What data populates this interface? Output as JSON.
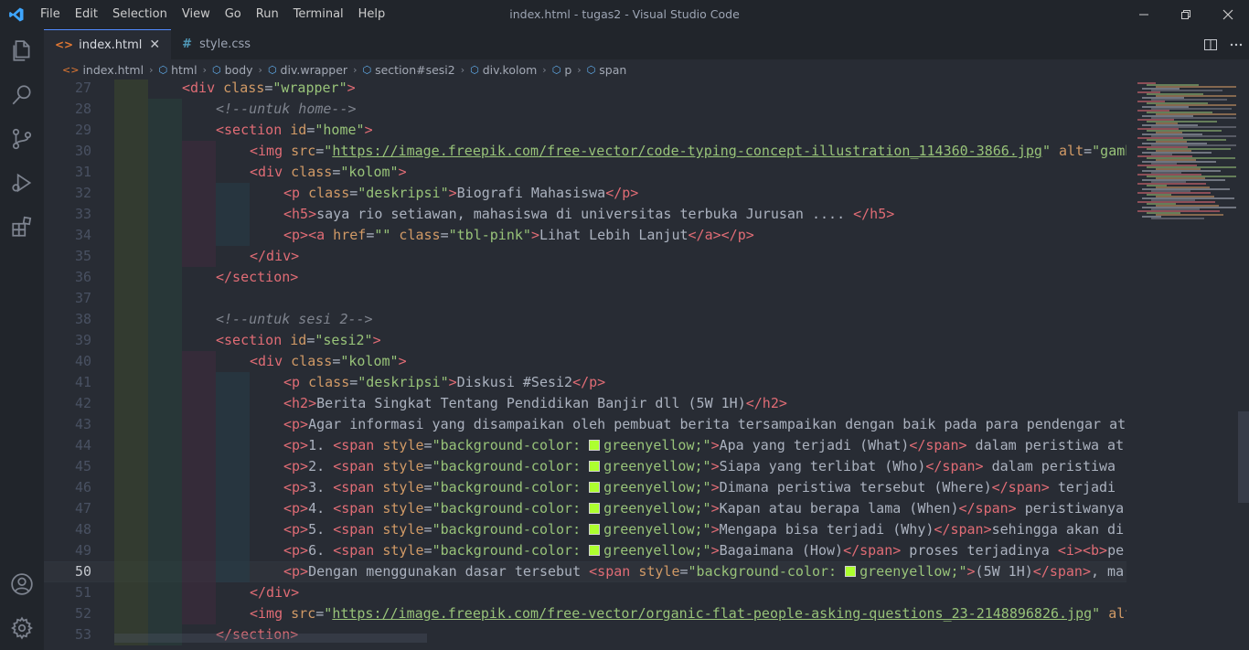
{
  "window": {
    "title": "index.html - tugas2 - Visual Studio Code",
    "menu": [
      "File",
      "Edit",
      "Selection",
      "View",
      "Go",
      "Run",
      "Terminal",
      "Help"
    ]
  },
  "activity_bar": {
    "top": [
      "files-icon",
      "search-icon",
      "source-control-icon",
      "run-debug-icon",
      "extensions-icon"
    ],
    "bottom": [
      "account-icon",
      "settings-gear-icon"
    ]
  },
  "tabs": [
    {
      "label": "index.html",
      "icon": "<>",
      "active": true,
      "close": "✕"
    },
    {
      "label": "style.css",
      "icon": "#",
      "active": false
    }
  ],
  "breadcrumbs": [
    {
      "label": "index.html",
      "icon": "<>"
    },
    {
      "label": "html",
      "icon": "⬡"
    },
    {
      "label": "body",
      "icon": "⬡"
    },
    {
      "label": "div.wrapper",
      "icon": "⬡"
    },
    {
      "label": "section#sesi2",
      "icon": "⬡"
    },
    {
      "label": "div.kolom",
      "icon": "⬡"
    },
    {
      "label": "p",
      "icon": "⬡"
    },
    {
      "label": "span",
      "icon": "⬡"
    }
  ],
  "colors": {
    "tag": "#e06c75",
    "attribute": "#d19a66",
    "string": "#98c379",
    "comment": "#7f848e",
    "swatch": "#adff2f",
    "accent": "#528bff"
  },
  "editor": {
    "current_line": 50,
    "lines": [
      {
        "n": "27",
        "indent": 1,
        "tokens": [
          [
            "tag",
            "<div"
          ],
          [
            "attr",
            " class"
          ],
          [
            "punc",
            "="
          ],
          [
            "str",
            "\"wrapper\""
          ],
          [
            "tag",
            ">"
          ]
        ]
      },
      {
        "n": "28",
        "indent": 2,
        "tokens": [
          [
            "comment",
            "<!--untuk home-->"
          ]
        ]
      },
      {
        "n": "29",
        "indent": 2,
        "tokens": [
          [
            "tag",
            "<section"
          ],
          [
            "attr",
            " id"
          ],
          [
            "punc",
            "="
          ],
          [
            "str",
            "\"home\""
          ],
          [
            "tag",
            ">"
          ]
        ]
      },
      {
        "n": "30",
        "indent": 3,
        "tokens": [
          [
            "tag",
            "<img"
          ],
          [
            "attr",
            " src"
          ],
          [
            "punc",
            "="
          ],
          [
            "str",
            "\""
          ],
          [
            "url",
            "https://image.freepik.com/free-vector/code-typing-concept-illustration_114360-3866.jpg"
          ],
          [
            "str",
            "\""
          ],
          [
            "attr",
            " alt"
          ],
          [
            "punc",
            "="
          ],
          [
            "str",
            "\"gamb"
          ]
        ]
      },
      {
        "n": "31",
        "indent": 3,
        "tokens": [
          [
            "tag",
            "<div"
          ],
          [
            "attr",
            " class"
          ],
          [
            "punc",
            "="
          ],
          [
            "str",
            "\"kolom\""
          ],
          [
            "tag",
            ">"
          ]
        ]
      },
      {
        "n": "32",
        "indent": 4,
        "tokens": [
          [
            "tag",
            "<p"
          ],
          [
            "attr",
            " class"
          ],
          [
            "punc",
            "="
          ],
          [
            "str",
            "\"deskripsi\""
          ],
          [
            "tag",
            ">"
          ],
          [
            "text",
            "Biografi Mahasiswa"
          ],
          [
            "tag",
            "</p>"
          ]
        ]
      },
      {
        "n": "33",
        "indent": 4,
        "tokens": [
          [
            "tag",
            "<h5>"
          ],
          [
            "text",
            "saya rio setiawan, mahasiswa di universitas terbuka Jurusan .... "
          ],
          [
            "tag",
            "</h5>"
          ]
        ]
      },
      {
        "n": "34",
        "indent": 4,
        "tokens": [
          [
            "tag",
            "<p><a"
          ],
          [
            "attr",
            " href"
          ],
          [
            "punc",
            "="
          ],
          [
            "str",
            "\"\""
          ],
          [
            "attr",
            " class"
          ],
          [
            "punc",
            "="
          ],
          [
            "str",
            "\"tbl-pink\""
          ],
          [
            "tag",
            ">"
          ],
          [
            "text",
            "Lihat Lebih Lanjut"
          ],
          [
            "tag",
            "</a></p>"
          ]
        ]
      },
      {
        "n": "35",
        "indent": 3,
        "tokens": [
          [
            "tag",
            "</div>"
          ]
        ]
      },
      {
        "n": "36",
        "indent": 2,
        "tokens": [
          [
            "tag",
            "</section>"
          ]
        ]
      },
      {
        "n": "37",
        "indent": 2,
        "tokens": []
      },
      {
        "n": "38",
        "indent": 2,
        "tokens": [
          [
            "comment",
            "<!--untuk sesi 2-->"
          ]
        ]
      },
      {
        "n": "39",
        "indent": 2,
        "tokens": [
          [
            "tag",
            "<section"
          ],
          [
            "attr",
            " id"
          ],
          [
            "punc",
            "="
          ],
          [
            "str",
            "\"sesi2\""
          ],
          [
            "tag",
            ">"
          ]
        ]
      },
      {
        "n": "40",
        "indent": 3,
        "tokens": [
          [
            "tag",
            "<div"
          ],
          [
            "attr",
            " class"
          ],
          [
            "punc",
            "="
          ],
          [
            "str",
            "\"kolom\""
          ],
          [
            "tag",
            ">"
          ]
        ]
      },
      {
        "n": "41",
        "indent": 4,
        "tokens": [
          [
            "tag",
            "<p"
          ],
          [
            "attr",
            " class"
          ],
          [
            "punc",
            "="
          ],
          [
            "str",
            "\"deskripsi\""
          ],
          [
            "tag",
            ">"
          ],
          [
            "text",
            "Diskusi #Sesi2"
          ],
          [
            "tag",
            "</p>"
          ]
        ]
      },
      {
        "n": "42",
        "indent": 4,
        "tokens": [
          [
            "tag",
            "<h2>"
          ],
          [
            "text",
            "Berita Singkat Tentang Pendidikan Banjir dll (5W 1H)"
          ],
          [
            "tag",
            "</h2>"
          ]
        ]
      },
      {
        "n": "43",
        "indent": 4,
        "tokens": [
          [
            "tag",
            "<p>"
          ],
          [
            "text",
            "Agar informasi yang disampaikan oleh pembuat berita tersampaikan dengan baik pada para pendengar ata"
          ]
        ]
      },
      {
        "n": "44",
        "indent": 4,
        "tokens": [
          [
            "tag",
            "<p>"
          ],
          [
            "text",
            "1. "
          ],
          [
            "tag",
            "<span"
          ],
          [
            "attr",
            " style"
          ],
          [
            "punc",
            "="
          ],
          [
            "str",
            "\"background-color: "
          ],
          [
            "swatch",
            ""
          ],
          [
            "str",
            "greenyellow;\""
          ],
          [
            "tag",
            ">"
          ],
          [
            "text",
            "Apa yang terjadi (What)"
          ],
          [
            "tag",
            "</span>"
          ],
          [
            "text",
            " dalam peristiwa at"
          ]
        ]
      },
      {
        "n": "45",
        "indent": 4,
        "tokens": [
          [
            "tag",
            "<p>"
          ],
          [
            "text",
            "2. "
          ],
          [
            "tag",
            "<span"
          ],
          [
            "attr",
            " style"
          ],
          [
            "punc",
            "="
          ],
          [
            "str",
            "\"background-color: "
          ],
          [
            "swatch",
            ""
          ],
          [
            "str",
            "greenyellow;\""
          ],
          [
            "tag",
            ">"
          ],
          [
            "text",
            "Siapa yang terlibat (Who)"
          ],
          [
            "tag",
            "</span>"
          ],
          [
            "text",
            " dalam peristiwa "
          ]
        ]
      },
      {
        "n": "46",
        "indent": 4,
        "tokens": [
          [
            "tag",
            "<p>"
          ],
          [
            "text",
            "3. "
          ],
          [
            "tag",
            "<span"
          ],
          [
            "attr",
            " style"
          ],
          [
            "punc",
            "="
          ],
          [
            "str",
            "\"background-color: "
          ],
          [
            "swatch",
            ""
          ],
          [
            "str",
            "greenyellow;\""
          ],
          [
            "tag",
            ">"
          ],
          [
            "text",
            "Dimana peristiwa tersebut (Where)"
          ],
          [
            "tag",
            "</span>"
          ],
          [
            "text",
            " terjadi "
          ]
        ]
      },
      {
        "n": "47",
        "indent": 4,
        "tokens": [
          [
            "tag",
            "<p>"
          ],
          [
            "text",
            "4. "
          ],
          [
            "tag",
            "<span"
          ],
          [
            "attr",
            " style"
          ],
          [
            "punc",
            "="
          ],
          [
            "str",
            "\"background-color: "
          ],
          [
            "swatch",
            ""
          ],
          [
            "str",
            "greenyellow;\""
          ],
          [
            "tag",
            ">"
          ],
          [
            "text",
            "Kapan atau berapa lama (When)"
          ],
          [
            "tag",
            "</span>"
          ],
          [
            "text",
            " peristiwanya"
          ]
        ]
      },
      {
        "n": "48",
        "indent": 4,
        "tokens": [
          [
            "tag",
            "<p>"
          ],
          [
            "text",
            "5. "
          ],
          [
            "tag",
            "<span"
          ],
          [
            "attr",
            " style"
          ],
          [
            "punc",
            "="
          ],
          [
            "str",
            "\"background-color: "
          ],
          [
            "swatch",
            ""
          ],
          [
            "str",
            "greenyellow;\""
          ],
          [
            "tag",
            ">"
          ],
          [
            "text",
            "Mengapa bisa terjadi (Why)"
          ],
          [
            "tag",
            "</span>"
          ],
          [
            "text",
            "sehingga akan di"
          ]
        ]
      },
      {
        "n": "49",
        "indent": 4,
        "tokens": [
          [
            "tag",
            "<p>"
          ],
          [
            "text",
            "6. "
          ],
          [
            "tag",
            "<span"
          ],
          [
            "attr",
            " style"
          ],
          [
            "punc",
            "="
          ],
          [
            "str",
            "\"background-color: "
          ],
          [
            "swatch",
            ""
          ],
          [
            "str",
            "greenyellow;\""
          ],
          [
            "tag",
            ">"
          ],
          [
            "text",
            "Bagaimana (How)"
          ],
          [
            "tag",
            "</span>"
          ],
          [
            "text",
            " proses terjadinya "
          ],
          [
            "tag",
            "<i><b>"
          ],
          [
            "text",
            "pe"
          ]
        ]
      },
      {
        "n": "50",
        "indent": 4,
        "tokens": [
          [
            "tag",
            "<p>"
          ],
          [
            "text",
            "Dengan menggunakan dasar tersebut "
          ],
          [
            "tag",
            "<span"
          ],
          [
            "attr",
            " style"
          ],
          [
            "punc",
            "="
          ],
          [
            "str",
            "\"background-color: "
          ],
          [
            "swatch",
            ""
          ],
          [
            "str",
            "greenyellow;\""
          ],
          [
            "tag",
            ">"
          ],
          [
            "text",
            "(5W 1H)"
          ],
          [
            "tag",
            "</span>"
          ],
          [
            "text",
            ", ma"
          ]
        ]
      },
      {
        "n": "51",
        "indent": 3,
        "tokens": [
          [
            "tag",
            "</div>"
          ]
        ]
      },
      {
        "n": "52",
        "indent": 3,
        "tokens": [
          [
            "tag",
            "<img"
          ],
          [
            "attr",
            " src"
          ],
          [
            "punc",
            "="
          ],
          [
            "str",
            "\""
          ],
          [
            "url",
            "https://image.freepik.com/free-vector/organic-flat-people-asking-questions_23-2148896826.jpg"
          ],
          [
            "str",
            "\""
          ],
          [
            "attr",
            " alt"
          ]
        ]
      },
      {
        "n": "53",
        "indent": 2,
        "tokens": [
          [
            "tag",
            "</section>"
          ]
        ]
      }
    ]
  }
}
